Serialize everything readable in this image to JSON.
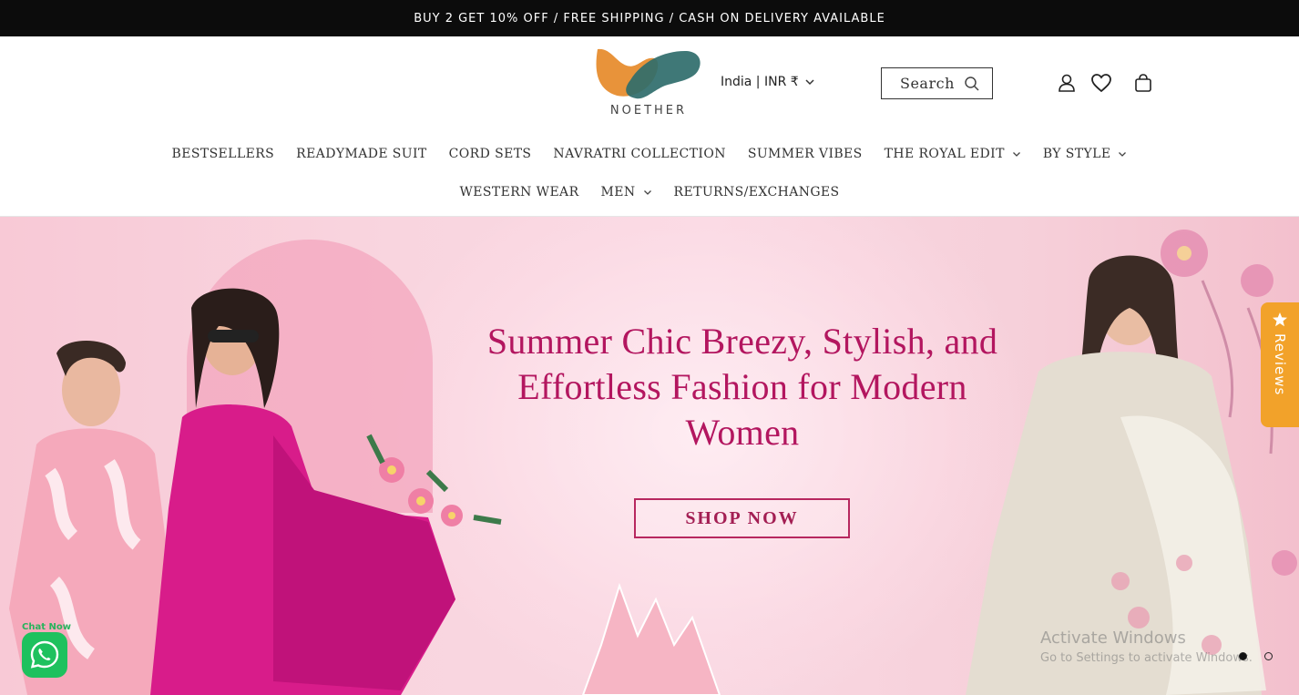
{
  "announcement": "BUY 2 GET 10% OFF / FREE SHIPPING / CASH ON DELIVERY AVAILABLE",
  "brand": {
    "name": "NOETHER"
  },
  "country": {
    "label": "India | INR ₹"
  },
  "search": {
    "label": "Search"
  },
  "nav": {
    "row1": [
      {
        "label": "BESTSELLERS",
        "dropdown": false
      },
      {
        "label": "READYMADE SUIT",
        "dropdown": false
      },
      {
        "label": "CORD SETS",
        "dropdown": false
      },
      {
        "label": "NAVRATRI COLLECTION",
        "dropdown": false
      },
      {
        "label": "SUMMER VIBES",
        "dropdown": false
      },
      {
        "label": "THE ROYAL EDIT",
        "dropdown": true
      },
      {
        "label": "BY STYLE",
        "dropdown": true
      }
    ],
    "row2": [
      {
        "label": "WESTERN WEAR",
        "dropdown": false
      },
      {
        "label": "MEN",
        "dropdown": true
      },
      {
        "label": "RETURNS/EXCHANGES",
        "dropdown": false
      }
    ]
  },
  "hero": {
    "headline": "Summer Chic Breezy, Stylish, and Effortless Fashion for Modern Women",
    "cta": "SHOP NOW",
    "slides": 2,
    "active_slide": 1
  },
  "reviews_tab": {
    "label": "Reviews"
  },
  "whatsapp": {
    "label": "Chat Now",
    "icon": "whatsapp-icon"
  },
  "watermark": {
    "line1": "Activate Windows",
    "line2": "Go to Settings to activate Windows."
  },
  "colors": {
    "accent": "#b3165f",
    "announce_bg": "#0c0c0c",
    "reviews": "#f2a22a",
    "whatsapp": "#1ec15e"
  }
}
